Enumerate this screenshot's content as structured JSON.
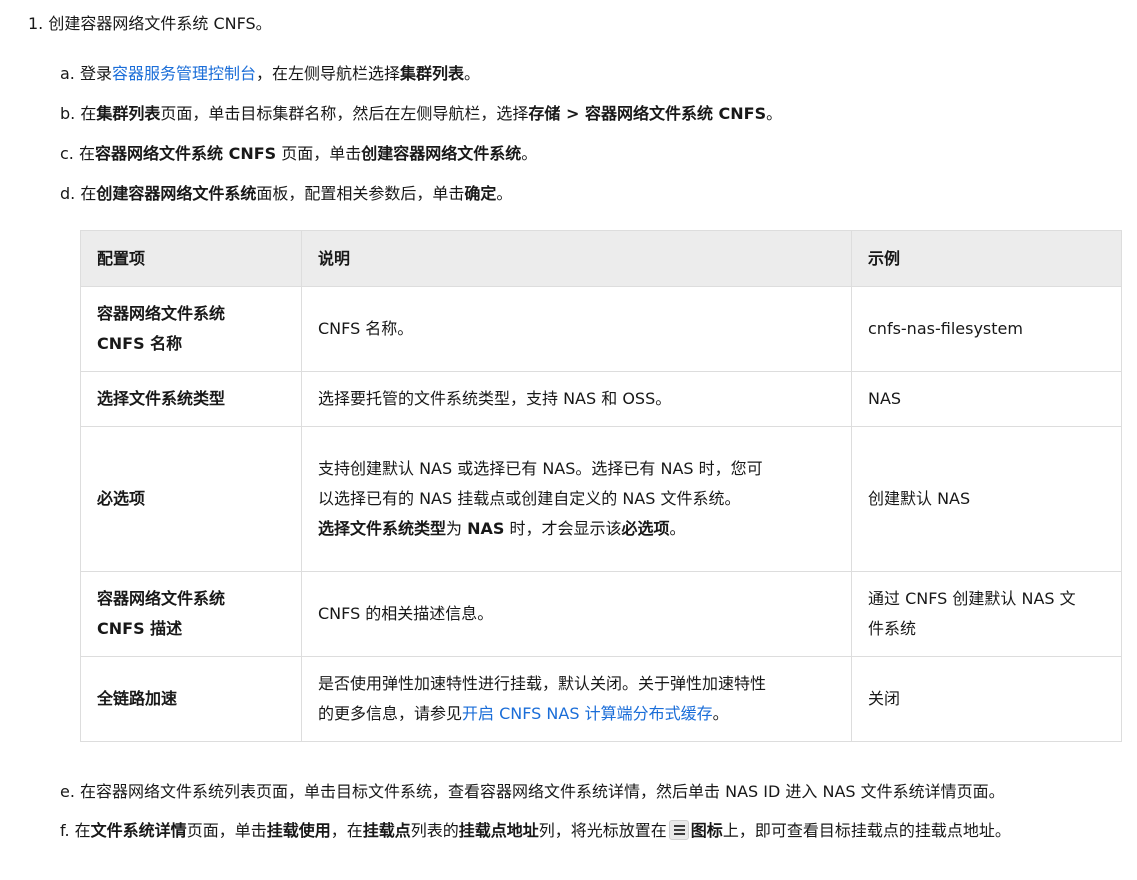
{
  "step1": {
    "marker": "1.",
    "text": "创建容器网络文件系统 CNFS。"
  },
  "substeps": {
    "a": {
      "marker": "a.",
      "t1": "登录",
      "link": "容器服务管理控制台",
      "t2": "，在左侧导航栏选择",
      "b1": "集群列表",
      "t3": "。"
    },
    "b": {
      "marker": "b.",
      "t1": "在",
      "b1": "集群列表",
      "t2": "页面，单击目标集群名称，然后在左侧导航栏，选择",
      "b2": "存储 > 容器网络文件系统 CNFS",
      "t3": "。"
    },
    "c": {
      "marker": "c.",
      "t1": "在",
      "b1": "容器网络文件系统 CNFS",
      "t2": " 页面，单击",
      "b2": "创建容器网络文件系统",
      "t3": "。"
    },
    "d": {
      "marker": "d.",
      "t1": "在",
      "b1": "创建容器网络文件系统",
      "t2": "面板，配置相关参数后，单击",
      "b2": "确定",
      "t3": "。"
    },
    "e": {
      "marker": "e.",
      "text": "在容器网络文件系统列表页面，单击目标文件系统，查看容器网络文件系统详情，然后单击 NAS ID 进入 NAS 文件系统详情页面。"
    },
    "f": {
      "marker": "f.",
      "t1": "在",
      "b1": "文件系统详情",
      "t2": "页面，单击",
      "b2": "挂载使用",
      "t3": "，在",
      "b3": "挂载点",
      "t4": "列表的",
      "b4": "挂载点地址",
      "t5": "列，将光标放置在",
      "icon": "list-icon",
      "b5": "图标",
      "t6": "上，即可查看目标挂载点的挂载点地址。"
    }
  },
  "table": {
    "headers": [
      "配置项",
      "说明",
      "示例"
    ],
    "rows": [
      {
        "key_line1": "容器网络文件系统",
        "key_line2": "CNFS 名称",
        "desc": "CNFS 名称。",
        "example": "cnfs-nas-filesystem"
      },
      {
        "key": "选择文件系统类型",
        "desc": "选择要托管的文件系统类型，支持 NAS 和 OSS。",
        "example": "NAS"
      },
      {
        "key": "必选项",
        "desc_line1": "支持创建默认 NAS 或选择已有 NAS。选择已有 NAS 时，您可",
        "desc_line2": "以选择已有的 NAS 挂载点或创建自定义的 NAS 文件系统。",
        "desc_b1": "选择文件系统类型",
        "desc_t1": "为 ",
        "desc_b2": "NAS",
        "desc_t2": " 时，才会显示该",
        "desc_b3": "必选项",
        "desc_t3": "。",
        "example": "创建默认 NAS"
      },
      {
        "key_line1": "容器网络文件系统",
        "key_line2": "CNFS 描述",
        "desc": "CNFS 的相关描述信息。",
        "example_line1": "通过 CNFS 创建默认 NAS 文",
        "example_line2": "件系统"
      },
      {
        "key": "全链路加速",
        "desc_line1": "是否使用弹性加速特性进行挂载，默认关闭。关于弹性加速特性",
        "desc_t1": "的更多信息，请参见",
        "desc_link": "开启 CNFS NAS 计算端分布式缓存",
        "desc_t2": "。",
        "example": "关闭"
      }
    ]
  },
  "colors": {
    "link": "#1a6dd8",
    "header_bg": "#ececec",
    "border": "#dddddd"
  }
}
